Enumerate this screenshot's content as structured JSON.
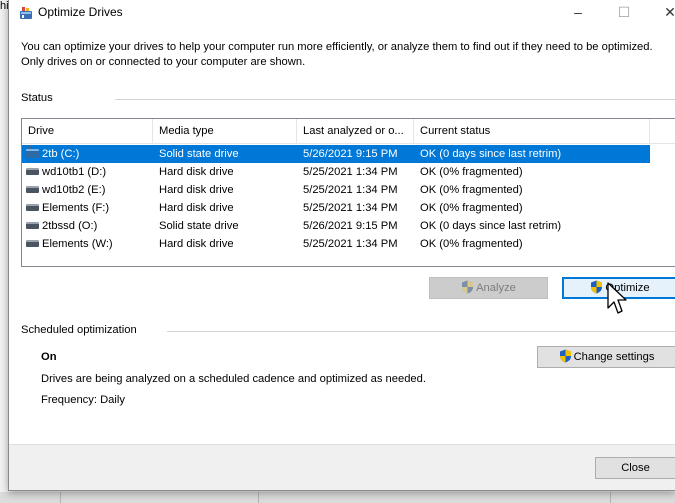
{
  "background": {
    "scrap_text": "hi"
  },
  "window": {
    "title": "Optimize Drives",
    "min_glyph": "–",
    "max_glyph": "☐",
    "close_glyph": "✕",
    "intro": "You can optimize your drives to help your computer run more efficiently, or analyze them to find out if they need to be optimized. Only drives on or connected to your computer are shown."
  },
  "status": {
    "label": "Status",
    "columns": [
      "Drive",
      "Media type",
      "Last analyzed or o...",
      "Current status"
    ],
    "rows": [
      {
        "drive": "2tb (C:)",
        "media": "Solid state drive",
        "last": "5/26/2021 9:15 PM",
        "status": "OK (0 days since last retrim)",
        "icon": "ssd-drive-icon",
        "selected": true
      },
      {
        "drive": "wd10tb1 (D:)",
        "media": "Hard disk drive",
        "last": "5/25/2021 1:34 PM",
        "status": "OK (0% fragmented)",
        "icon": "hard-drive-icon",
        "selected": false
      },
      {
        "drive": "wd10tb2 (E:)",
        "media": "Hard disk drive",
        "last": "5/25/2021 1:34 PM",
        "status": "OK (0% fragmented)",
        "icon": "hard-drive-icon",
        "selected": false
      },
      {
        "drive": "Elements (F:)",
        "media": "Hard disk drive",
        "last": "5/25/2021 1:34 PM",
        "status": "OK (0% fragmented)",
        "icon": "hard-drive-icon",
        "selected": false
      },
      {
        "drive": "2tbssd (O:)",
        "media": "Solid state drive",
        "last": "5/26/2021 9:15 PM",
        "status": "OK (0 days since last retrim)",
        "icon": "hard-drive-icon",
        "selected": false
      },
      {
        "drive": "Elements (W:)",
        "media": "Hard disk drive",
        "last": "5/25/2021 1:34 PM",
        "status": "OK (0% fragmented)",
        "icon": "hard-drive-icon",
        "selected": false
      }
    ]
  },
  "actions": {
    "analyze_label": "Analyze",
    "optimize_label": "Optimize"
  },
  "scheduled": {
    "label": "Scheduled optimization",
    "state": "On",
    "description": "Drives are being analyzed on a scheduled cadence and optimized as needed.",
    "frequency": "Frequency: Daily",
    "change_settings_label": "Change settings"
  },
  "footer": {
    "close_label": "Close"
  },
  "colors": {
    "selection": "#0078d7",
    "shield_blue": "#1f5fbf",
    "shield_yellow": "#f2c200"
  }
}
